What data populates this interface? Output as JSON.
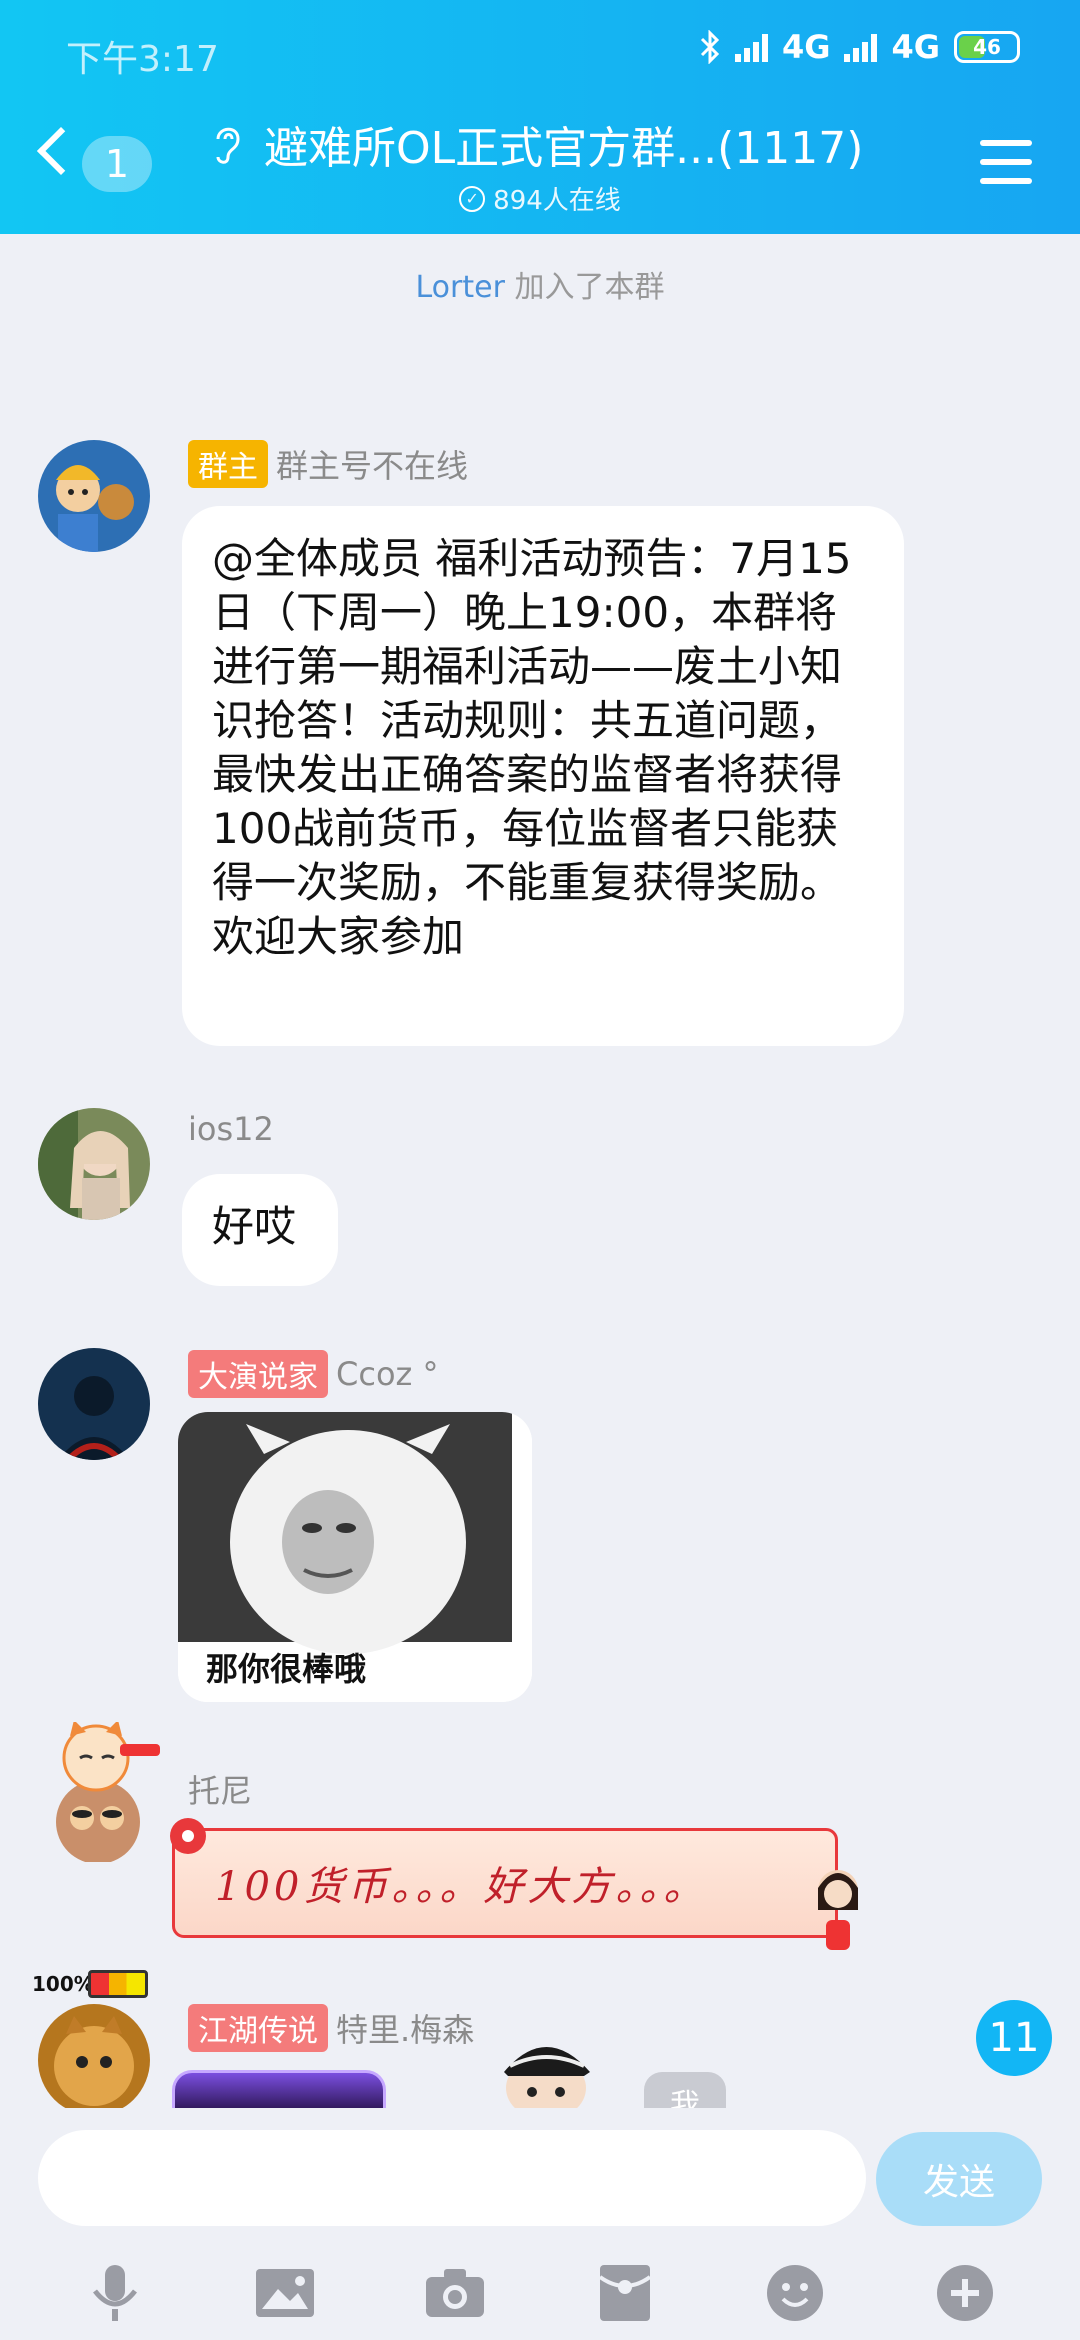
{
  "status_bar": {
    "time": "下午3:17",
    "network1": "4G",
    "network2": "4G",
    "battery": "46"
  },
  "header": {
    "unread": "1",
    "title": "避难所OL正式官方群...(1117)",
    "online": "894人在线"
  },
  "system": {
    "name": "Lorter",
    "text": " 加入了本群"
  },
  "messages": [
    {
      "badge": "群主",
      "name": "群主号不在线",
      "text": "@全体成员 福利活动预告：7月15日（下周一）晚上19:00，本群将进行第一期福利活动——废土小知识抢答！活动规则：共五道问题，最快发出正确答案的监督者将获得100战前货币，每位监督者只能获得一次奖励，不能重复获得奖励。欢迎大家参加"
    },
    {
      "name": "ios12",
      "text": "好哎"
    },
    {
      "badge": "大演说家",
      "name": "Ccoz °",
      "sticker_caption": "那你很棒哦"
    },
    {
      "name": "托尼",
      "text": "100货币。。。好大方。。。"
    },
    {
      "badge": "江湖传说",
      "name": "特里.梅森",
      "battery_label": "100%",
      "partial_text": "我"
    }
  ],
  "floating_unread": "11",
  "input": {
    "placeholder": "",
    "send": "发送"
  },
  "toolbar": [
    "microphone-icon",
    "image-icon",
    "camera-icon",
    "red-packet-icon",
    "emoji-icon",
    "plus-icon"
  ]
}
